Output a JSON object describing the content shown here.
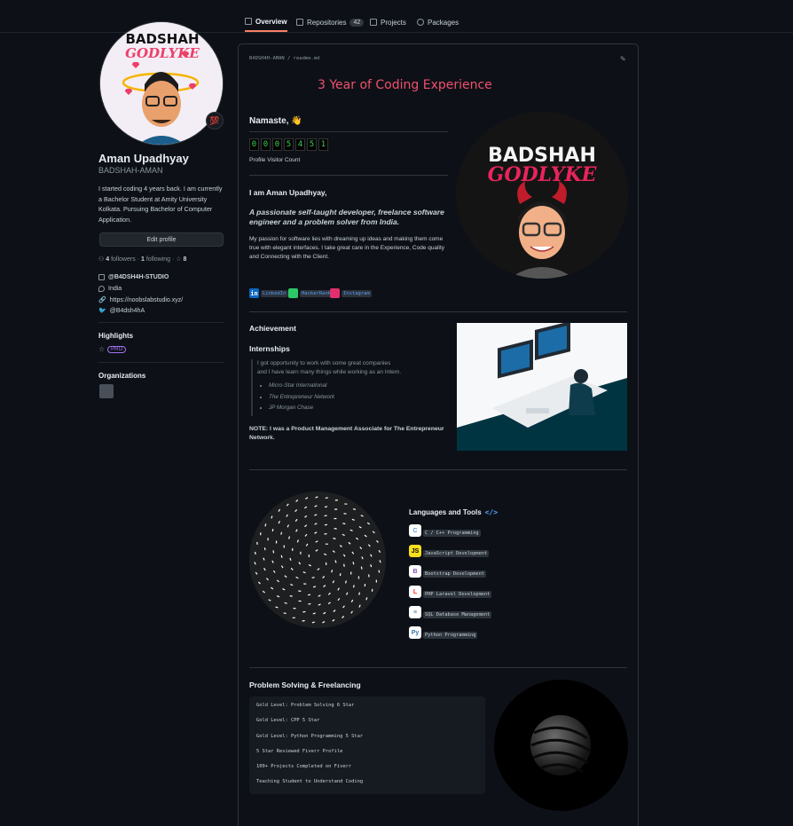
{
  "nav": {
    "tabs": [
      {
        "label": "Overview",
        "active": true
      },
      {
        "label": "Repositories",
        "count": "42"
      },
      {
        "label": "Projects"
      },
      {
        "label": "Packages"
      }
    ]
  },
  "profile": {
    "avatar_text_top": "BADSHAH",
    "avatar_text_bottom": "GODLYKE",
    "status_emoji": "💯",
    "full_name": "Aman Upadhyay",
    "username": "BADSHAH-AMAN",
    "bio": "I started coding 4 years back. I am currently a Bachelor Student at Amity University Kolkata. Pursuing Bachelor of Computer Application.",
    "edit_label": "Edit profile",
    "followers_count": "4",
    "followers_label": "followers",
    "following_count": "1",
    "following_label": "following",
    "stars_count": "8",
    "org": "@B4DSH4H-STUDIO",
    "location": "India",
    "website": "https://noobslabstudio.xyz/",
    "twitter": "@B4dsh4hA",
    "highlights_title": "Highlights",
    "pro_label": "PRO",
    "orgs_title": "Organizations"
  },
  "readme": {
    "breadcrumb": "B4DSH4H-AMAN / readme.md",
    "title": "3 Year of Coding Experience",
    "namaste": "Namaste, 👋",
    "visitor_digits": [
      "0",
      "0",
      "0",
      "5",
      "4",
      "5",
      "1"
    ],
    "visitor_label": "Profile Visitor Count",
    "logo_top": "BADSHAH",
    "logo_bottom": "GODLYKE",
    "iam": "I am Aman Upadhyay,",
    "tagline": "A passionate self-taught developer, freelance software engineer and a problem solver from India.",
    "paragraph": "My passion for software lies with dreaming up ideas and making them come true with elegant interfaces. I take great care in the Experience, Code quality and Connecting with the Client.",
    "social": [
      "LinkedIn",
      "HackerRank",
      "Instagram"
    ],
    "achievement": "Achievement",
    "internships": "Internships",
    "quote_line1": "I got opportunity to work with some great companies",
    "quote_line2": "and I have learn many things while working as an Intern.",
    "companies": [
      "Micro-Star International",
      "The Entrepreneur Network",
      "JP Morgan Chase"
    ],
    "note": "NOTE: I was a Product Management Associate for The Entrepreneur Network.",
    "languages_title": "Languages and Tools",
    "languages_code": "</>",
    "languages": [
      {
        "icon": "C",
        "label": "C / C++ Programming",
        "color": "#659ad2"
      },
      {
        "icon": "JS",
        "label": "JavaScript Development",
        "color": "#f7df1e"
      },
      {
        "icon": "B",
        "label": "Bootstrap Development",
        "color": "#7952b3"
      },
      {
        "icon": "L",
        "label": "PHP Laravel Development",
        "color": "#ff2d20"
      },
      {
        "icon": "≡",
        "label": "SQL Database Management",
        "color": "#4479a1"
      },
      {
        "icon": "Py",
        "label": "Python Programming",
        "color": "#3776ab"
      }
    ],
    "ps_title": "Problem Solving & Freelancing",
    "ps_lines": [
      "Gold Level: Problem Solving 6 Star",
      "Gold Level: CPP 5 Star",
      "Gold Level: Python Programming 5 Star",
      "5 Star Reviewed Fiverr Profile",
      "100+ Projects Completed on Fiverr",
      "Teaching Student to Understand Coding"
    ]
  }
}
